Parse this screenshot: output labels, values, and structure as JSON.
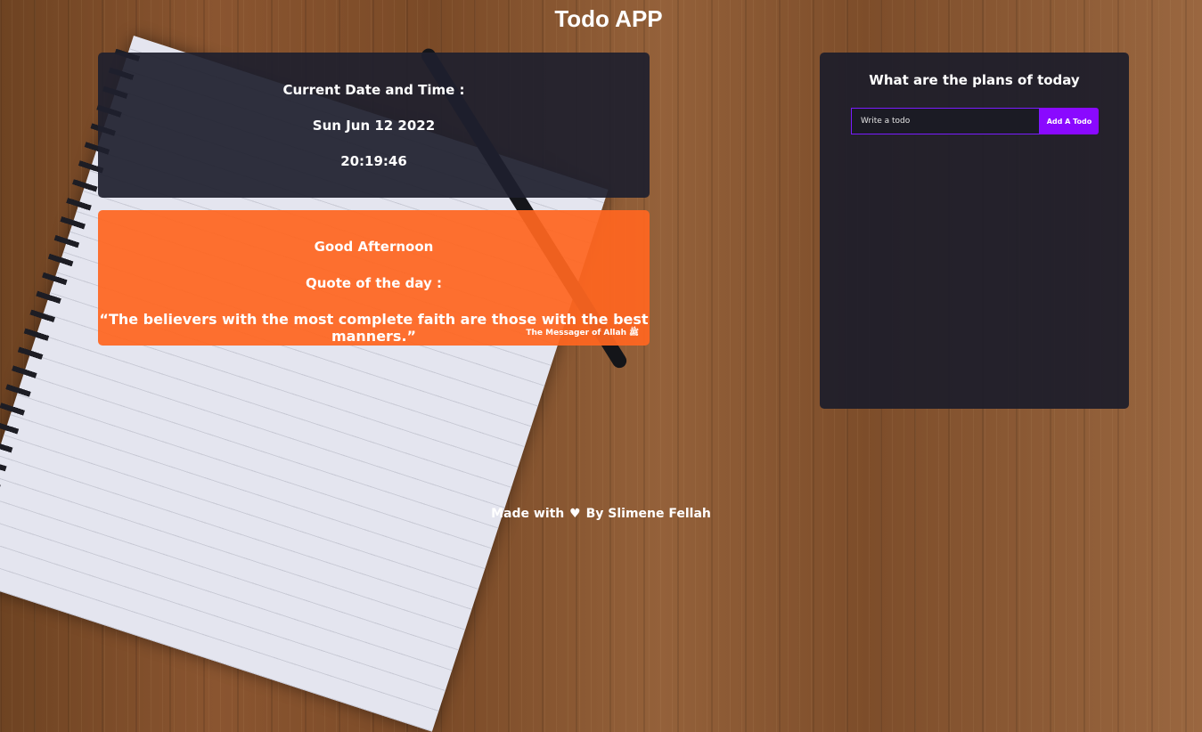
{
  "app": {
    "title": "Todo APP"
  },
  "clock": {
    "heading": "Current Date and Time :",
    "date": "Sun Jun 12 2022",
    "time": "20:19:46"
  },
  "greeting": {
    "text": "Good Afternoon",
    "quote_heading": "Quote of the day :",
    "quote": "“The believers with the most complete faith are those with the best manners.”",
    "source": "The Messager of Allah ﷺ"
  },
  "todo": {
    "title": "What are the plans of today",
    "input_placeholder": "Write a todo",
    "input_value": "",
    "add_label": "Add A Todo"
  },
  "footer": {
    "made_with": "Made with",
    "heart_icon": "heart-icon",
    "heart_glyph": "♥",
    "by": "By Slimene Fellah"
  },
  "colors": {
    "clock_card": "#1e202e",
    "quote_card": "#ff6620",
    "todo_panel": "#1e1e2a",
    "accent": "#8a09ff"
  }
}
